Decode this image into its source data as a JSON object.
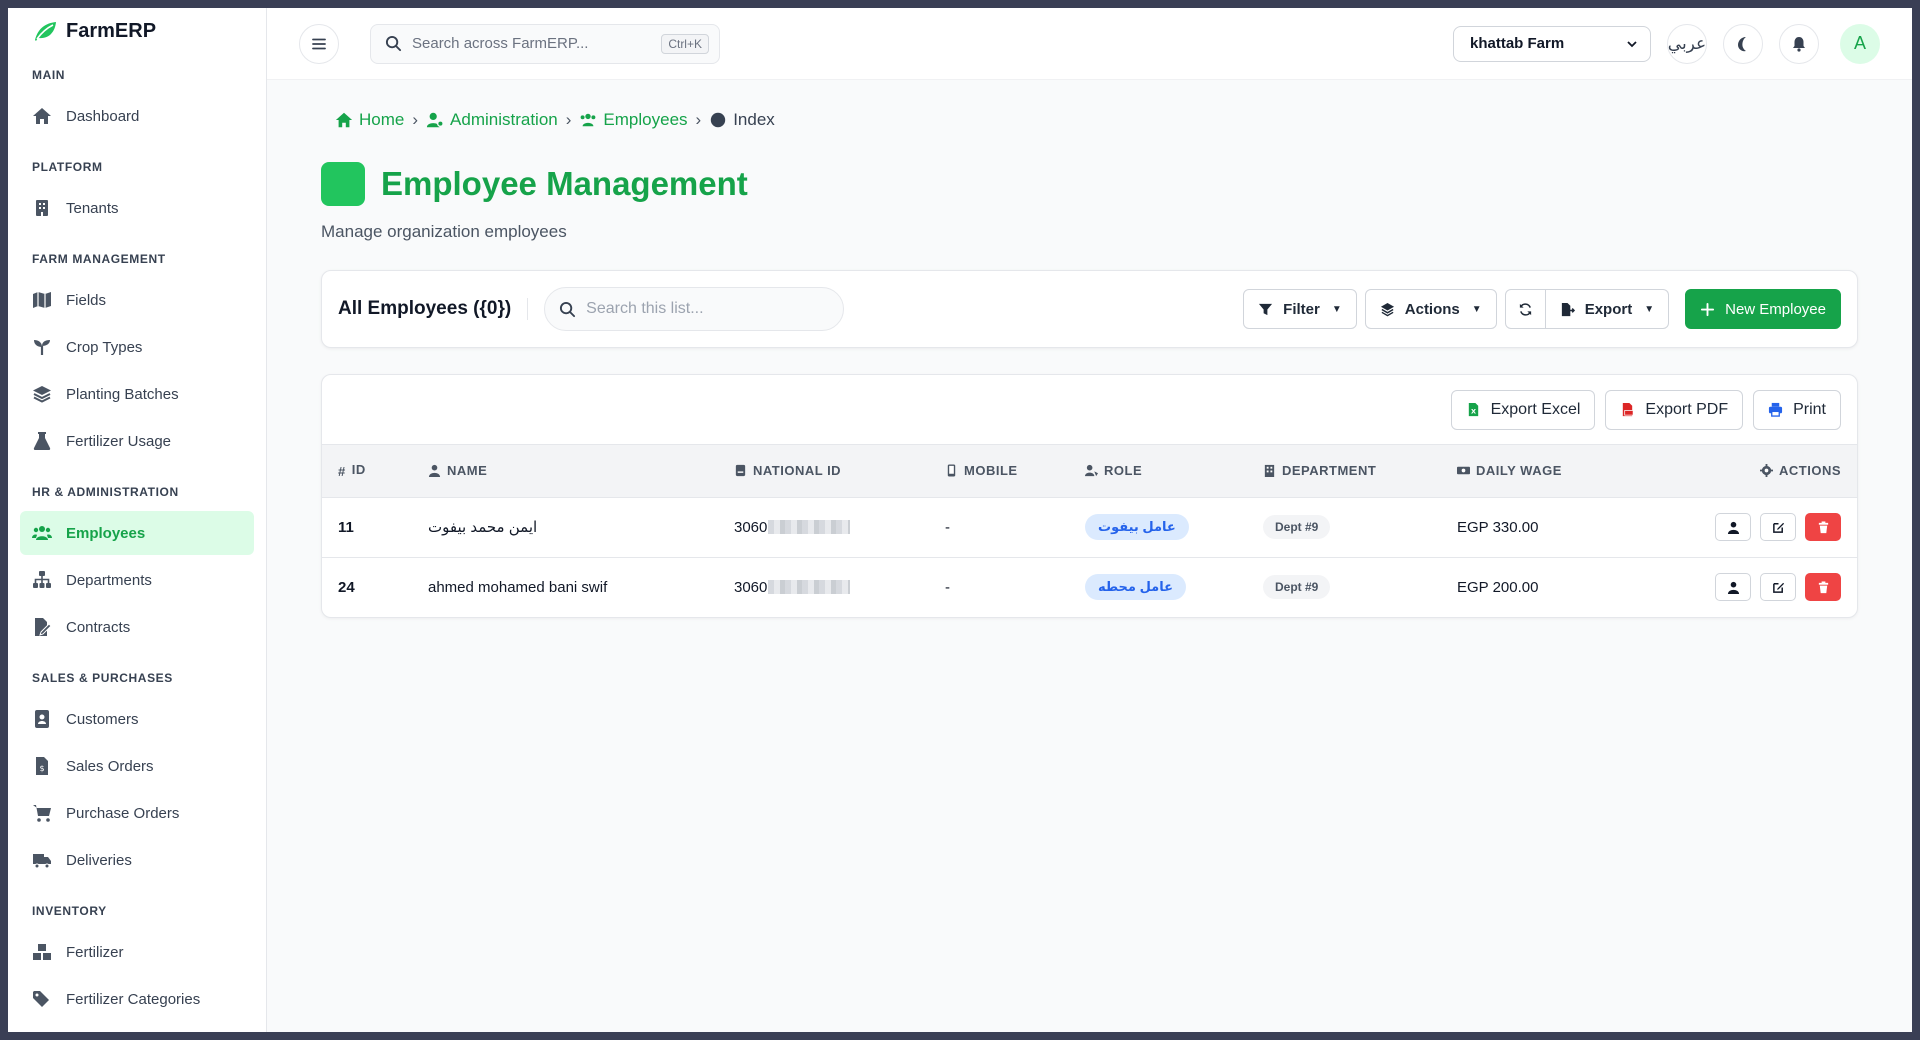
{
  "brand": {
    "name": "FarmERP"
  },
  "sidebar": {
    "sections": [
      {
        "label": "MAIN",
        "items": [
          {
            "label": "Dashboard",
            "icon": "home-icon"
          }
        ]
      },
      {
        "label": "PLATFORM",
        "items": [
          {
            "label": "Tenants",
            "icon": "building-icon"
          }
        ]
      },
      {
        "label": "FARM MANAGEMENT",
        "items": [
          {
            "label": "Fields",
            "icon": "map-icon"
          },
          {
            "label": "Crop Types",
            "icon": "seedling-icon"
          },
          {
            "label": "Planting Batches",
            "icon": "layers-icon"
          },
          {
            "label": "Fertilizer Usage",
            "icon": "flask-icon"
          }
        ]
      },
      {
        "label": "HR & ADMINISTRATION",
        "items": [
          {
            "label": "Employees",
            "icon": "users-icon",
            "active": true
          },
          {
            "label": "Departments",
            "icon": "sitemap-icon"
          },
          {
            "label": "Contracts",
            "icon": "contract-icon"
          }
        ]
      },
      {
        "label": "SALES & PURCHASES",
        "items": [
          {
            "label": "Customers",
            "icon": "address-book-icon"
          },
          {
            "label": "Sales Orders",
            "icon": "invoice-icon"
          },
          {
            "label": "Purchase Orders",
            "icon": "cart-icon"
          },
          {
            "label": "Deliveries",
            "icon": "truck-icon"
          }
        ]
      },
      {
        "label": "INVENTORY",
        "items": [
          {
            "label": "Fertilizer",
            "icon": "boxes-icon"
          },
          {
            "label": "Fertilizer Categories",
            "icon": "tags-icon"
          }
        ]
      }
    ]
  },
  "topbar": {
    "search_placeholder": "Search across FarmERP...",
    "search_shortcut": "Ctrl+K",
    "tenant": "khattab Farm",
    "language": "عربي",
    "avatar_initial": "A"
  },
  "breadcrumb": {
    "home": "Home",
    "admin": "Administration",
    "employees": "Employees",
    "current": "Index"
  },
  "page": {
    "title": "Employee Management",
    "subtitle": "Manage organization employees"
  },
  "toolbar": {
    "title": "All Employees ({0})",
    "search_placeholder": "Search this list...",
    "filter": "Filter",
    "actions": "Actions",
    "export": "Export",
    "new": "New Employee"
  },
  "export_buttons": {
    "excel": "Export Excel",
    "pdf": "Export PDF",
    "print": "Print"
  },
  "table": {
    "columns": {
      "id": "ID",
      "name": "NAME",
      "national_id": "NATIONAL ID",
      "mobile": "MOBILE",
      "role": "ROLE",
      "department": "DEPARTMENT",
      "daily_wage": "DAILY WAGE",
      "actions": "ACTIONS"
    },
    "rows": [
      {
        "id": "11",
        "name": "ايمن محمد بيفوت",
        "national_id": "3060",
        "mobile": "-",
        "role": "عامل بيفوت",
        "department": "Dept #9",
        "daily_wage": "EGP 330.00"
      },
      {
        "id": "24",
        "name": "ahmed mohamed bani swif",
        "national_id": "3060",
        "mobile": "-",
        "role": "عامل محطه",
        "department": "Dept #9",
        "daily_wage": "EGP 200.00"
      }
    ]
  },
  "colors": {
    "accent": "#16a34a",
    "accent_light": "#dcfce7",
    "danger": "#ef4444",
    "badge_blue": "#2563eb"
  }
}
